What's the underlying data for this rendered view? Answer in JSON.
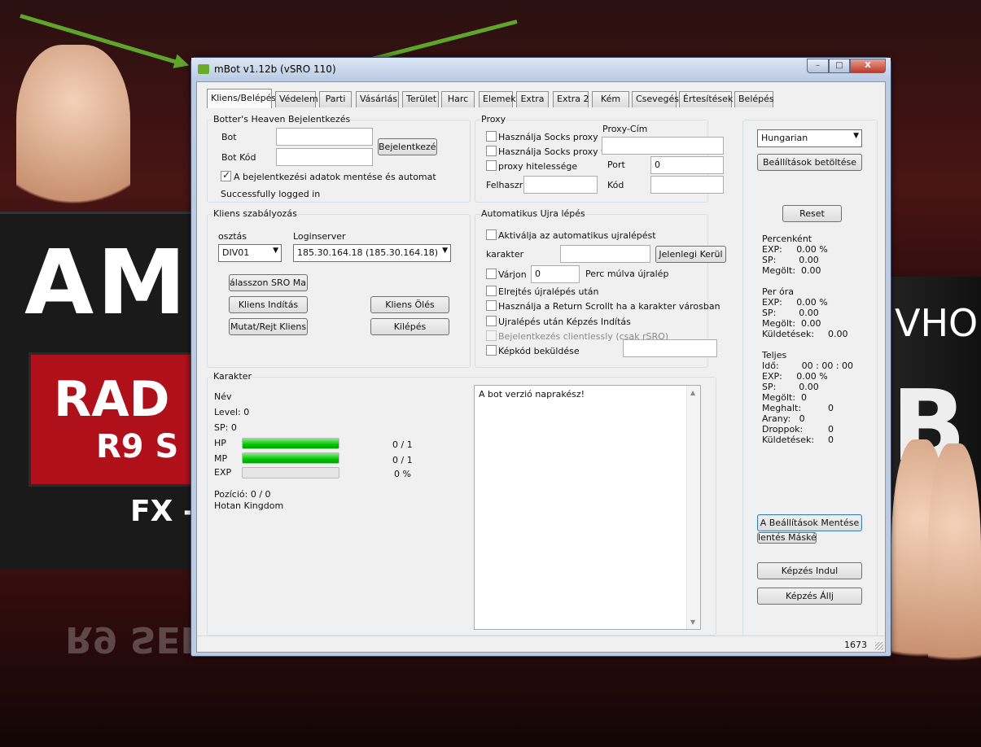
{
  "window": {
    "title": "mBot v1.12b (vSRO 110)",
    "minimize": "–",
    "maximize": "□",
    "close": "X"
  },
  "tabs": [
    "Kliens/Belépés",
    "Védelem",
    "Parti",
    "Vásárlás",
    "Terület",
    "Harc",
    "Elemek",
    "Extra",
    "Extra 2",
    "Kém",
    "Csevegés",
    "Értesítések",
    "Belépés"
  ],
  "login": {
    "group": "Botter's Heaven Bejelentkezés",
    "bot_label": "Bot",
    "bot_value": "",
    "code_label": "Bot Kód",
    "code_value": "",
    "login_button": "Bejelentkezés",
    "save_checkbox": "A bejelentkezési adatok mentése és automat",
    "status": "Successfully logged in"
  },
  "proxy": {
    "group": "Proxy",
    "use_socks_1": "Használja Socks proxy",
    "use_socks_2": "Használja Socks proxy v",
    "auth": "proxy hitelessége",
    "user_label": "Felhaszr",
    "address_label": "Proxy-Cím",
    "port_label": "Port",
    "port_value": "0",
    "code_label": "Kód"
  },
  "client": {
    "group": "Kliens szabályozás",
    "class_label": "osztás",
    "class_value": "DIV01",
    "loginserver_label": "Loginserver",
    "loginserver_value": "185.30.164.18 (185.30.164.18)",
    "choose_folder": "álasszon SRO Mappá",
    "start": "Kliens Indítás",
    "kill": "Kliens Ölés",
    "toggle": "Mutat/Rejt Kliens",
    "exit": "Kilépés"
  },
  "relogin": {
    "group": "Automatikus Ujra lépés",
    "enable": "Aktiválja az automatikus ujralépést",
    "char_label": "karakter",
    "current_button": "Jelenlegi Kerül",
    "wait_label": "Várjon",
    "wait_value": "0",
    "wait_suffix": "Perc múlva újralép",
    "hide": "Elrejtés újralépés után",
    "return_scroll": "Használja a Return Scrollt ha a karakter városban",
    "train_after": "Ujralépés után Képzés Indítás",
    "clientless": "Bejelentkezés clientlessly (csak rSRO)",
    "captcha": "Képkód beküldése"
  },
  "character": {
    "group": "Karakter",
    "name_label": "Név",
    "level": "Level: 0",
    "sp": "SP: 0",
    "hp_label": "HP",
    "hp_value": "0 / 1",
    "hp_fill": 1.0,
    "mp_label": "MP",
    "mp_value": "0 / 1",
    "mp_fill": 1.0,
    "exp_label": "EXP",
    "exp_value": "0 %",
    "exp_fill": 0.0,
    "position": "Pozíció: 0 / 0",
    "location": "Hotan Kingdom"
  },
  "log": {
    "line1": "A bot verzió naprakész!"
  },
  "side": {
    "language": "Hungarian",
    "load_settings": "Beállítások betöltése",
    "reset": "Reset",
    "per_min_title": "Percenként",
    "pm_exp": "EXP:     0.00 %",
    "pm_sp": "SP:        0.00",
    "pm_kills": "Megölt:  0.00",
    "per_hour_title": "Per óra",
    "ph_exp": "EXP:     0.00 %",
    "ph_sp": "SP:        0.00",
    "ph_kills": "Megölt:  0.00",
    "ph_sent_label": "Küldetések:",
    "ph_sent_value": "0.00",
    "total_title": "Teljes",
    "t_time": "Idő:        00 : 00 : 00",
    "t_exp": "EXP:     0.00 %",
    "t_sp": "SP:        0.00",
    "t_kills": "Megölt:  0",
    "t_died_label": "Meghalt:",
    "t_died_value": "0",
    "t_gold": "Arany:   0",
    "t_drops_label": "Droppok:",
    "t_drops_value": "0",
    "t_sent_label": "Küldetések:",
    "t_sent_value": "0",
    "save_settings": "A Beállítások Mentése",
    "save_as": "lentés Máskén",
    "train_start": "Képzés Indul",
    "train_stop": "Képzés Állj"
  },
  "status": {
    "counter": "1673"
  },
  "background": {
    "left_big": "AM",
    "left_r1": "RAD",
    "left_r2": "R9 S",
    "left_fx": "FX -",
    "right_w": "VHO",
    "right_b": "B",
    "refl": "R9 SERIES"
  }
}
